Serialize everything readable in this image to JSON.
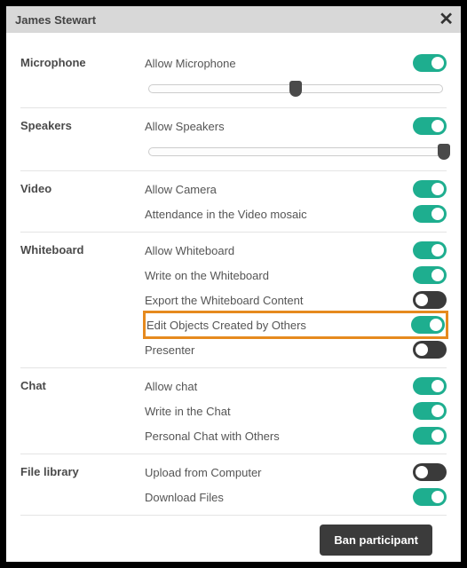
{
  "title": "James Stewart",
  "groups": {
    "microphone": {
      "label": "Microphone",
      "allow": {
        "label": "Allow Microphone",
        "on": true
      },
      "slider": 50
    },
    "speakers": {
      "label": "Speakers",
      "allow": {
        "label": "Allow Speakers",
        "on": true
      },
      "slider": 100
    },
    "video": {
      "label": "Video",
      "camera": {
        "label": "Allow Camera",
        "on": true
      },
      "mosaic": {
        "label": "Attendance in the Video mosaic",
        "on": true
      }
    },
    "whiteboard": {
      "label": "Whiteboard",
      "allow": {
        "label": "Allow Whiteboard",
        "on": true
      },
      "write": {
        "label": "Write on the Whiteboard",
        "on": true
      },
      "export": {
        "label": "Export the Whiteboard Content",
        "on": false
      },
      "edit_others": {
        "label": "Edit Objects Created by Others",
        "on": true,
        "highlight": true
      },
      "presenter": {
        "label": "Presenter",
        "on": false
      }
    },
    "chat": {
      "label": "Chat",
      "allow": {
        "label": "Allow chat",
        "on": true
      },
      "write": {
        "label": "Write in the Chat",
        "on": true
      },
      "personal": {
        "label": "Personal Chat with Others",
        "on": true
      }
    },
    "files": {
      "label": "File library",
      "upload": {
        "label": "Upload from Computer",
        "on": false
      },
      "download": {
        "label": "Download Files",
        "on": true
      }
    }
  },
  "ban_label": "Ban participant"
}
